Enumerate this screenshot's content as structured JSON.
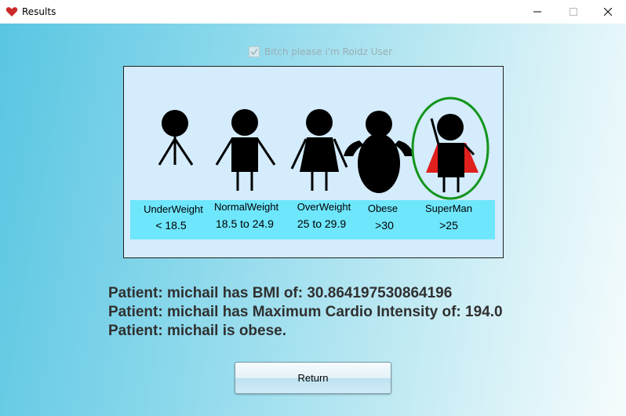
{
  "window": {
    "title": "Results"
  },
  "checkbox": {
    "label": "Bitch please i'm Roidz User",
    "checked": true,
    "enabled": false
  },
  "bmi_chart": {
    "categories": [
      {
        "name": "UnderWeight",
        "range": "< 18.5"
      },
      {
        "name": "NormalWeight",
        "range": "18.5 to 24.9"
      },
      {
        "name": "OverWeight",
        "range": "25 to 29.9"
      },
      {
        "name": "Obese",
        "range": ">30"
      },
      {
        "name": "SuperMan",
        "range": ">25"
      }
    ],
    "highlighted": "SuperMan",
    "colors": {
      "background": "#d4ecfc",
      "label_band": "#6ee6fc",
      "highlight_ring": "#13951c",
      "cape": "#e0201c"
    }
  },
  "results": {
    "line1": "Patient: michail has BMI of: 30.864197530864196",
    "line2": "Patient: michail has Maximum Cardio Intensity of: 194.0",
    "line3": "Patient: michail is obese."
  },
  "return_button": {
    "label": "Return"
  }
}
